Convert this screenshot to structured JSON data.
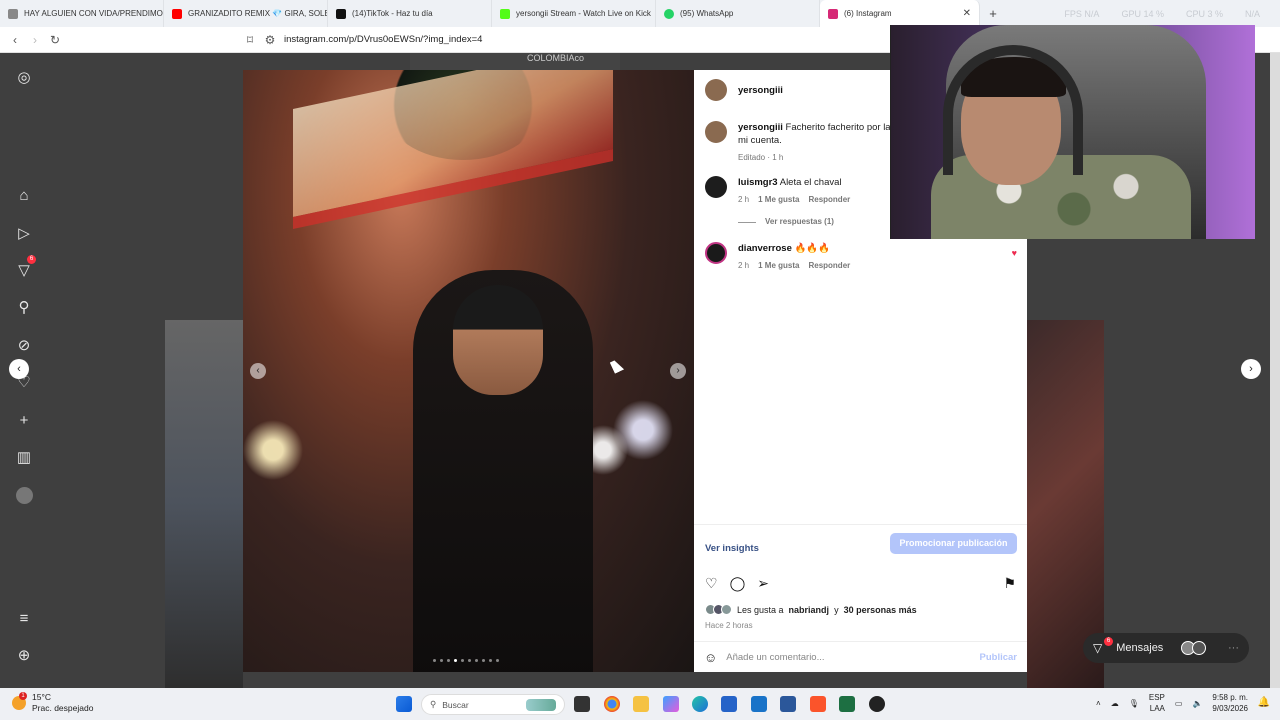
{
  "browser": {
    "tabs": [
      {
        "label": "HAY ALGUIEN CON VIDA/PRENDIMO",
        "color": "#888888"
      },
      {
        "label": "GRANIZADITO REMIX 💎 GIRA, SOLE",
        "color": "#ff0000"
      },
      {
        "label": "(14)TikTok - Haz tu día",
        "color": "#111111"
      },
      {
        "label": "yersongii Stream - Watch Live on Kick",
        "color": "#53fc18"
      },
      {
        "label": "(95) WhatsApp",
        "color": "#25d366"
      },
      {
        "label": "(6) Instagram",
        "color": "#d62976"
      }
    ],
    "new_tab": "+",
    "close_tab": "✕",
    "stats": [
      "FPS N/A",
      "GPU 14 %",
      "CPU 3 %",
      "N/A"
    ],
    "url": "instagram.com/p/DVrus0oEWSn/?img_index=4"
  },
  "background": {
    "text": "COLOMBIAco"
  },
  "sidebar": {
    "icons": [
      "instagram-icon",
      "home-icon",
      "reels-icon",
      "notifications-icon",
      "search-icon",
      "explore-icon",
      "heart-icon",
      "create-icon",
      "insights-icon",
      "profile-icon",
      "menu-icon",
      "threads-icon"
    ],
    "badge": "6"
  },
  "post": {
    "author": "yersongiii",
    "caption_user": "yersongiii",
    "caption": "Facherito facherito por la",
    "caption_cont": "mi cuenta.",
    "caption_meta": "Editado · 1 h",
    "comments": [
      {
        "user": "luismgr3",
        "text": "Aleta el chaval",
        "time": "2 h",
        "likes": "1 Me gusta",
        "reply": "Responder",
        "view_replies": "Ver respuestas (1)"
      },
      {
        "user": "dianverrose",
        "text": "🔥🔥🔥",
        "time": "2 h",
        "likes": "1 Me gusta",
        "reply": "Responder"
      }
    ],
    "insights": "Ver insights",
    "promote": "Promocionar publicación",
    "likes_prefix": "Les gusta a",
    "likes_user": "nabriandj",
    "likes_and": "y",
    "likes_count": "30 personas más",
    "posted_ago": "Hace 2 horas",
    "comment_placeholder": "Añade un comentario...",
    "publish": "Publicar",
    "carousel_index": 4,
    "carousel_total": 10
  },
  "messages": {
    "label": "Mensajes",
    "badge": "6",
    "more": "···"
  },
  "taskbar": {
    "temp": "15°C",
    "weather": "Prac. despejado",
    "weather_badge": "1",
    "search": "Buscar",
    "lang": "ESP",
    "lang2": "LAA",
    "time": "9:58 p. m.",
    "date": "9/03/2026"
  }
}
